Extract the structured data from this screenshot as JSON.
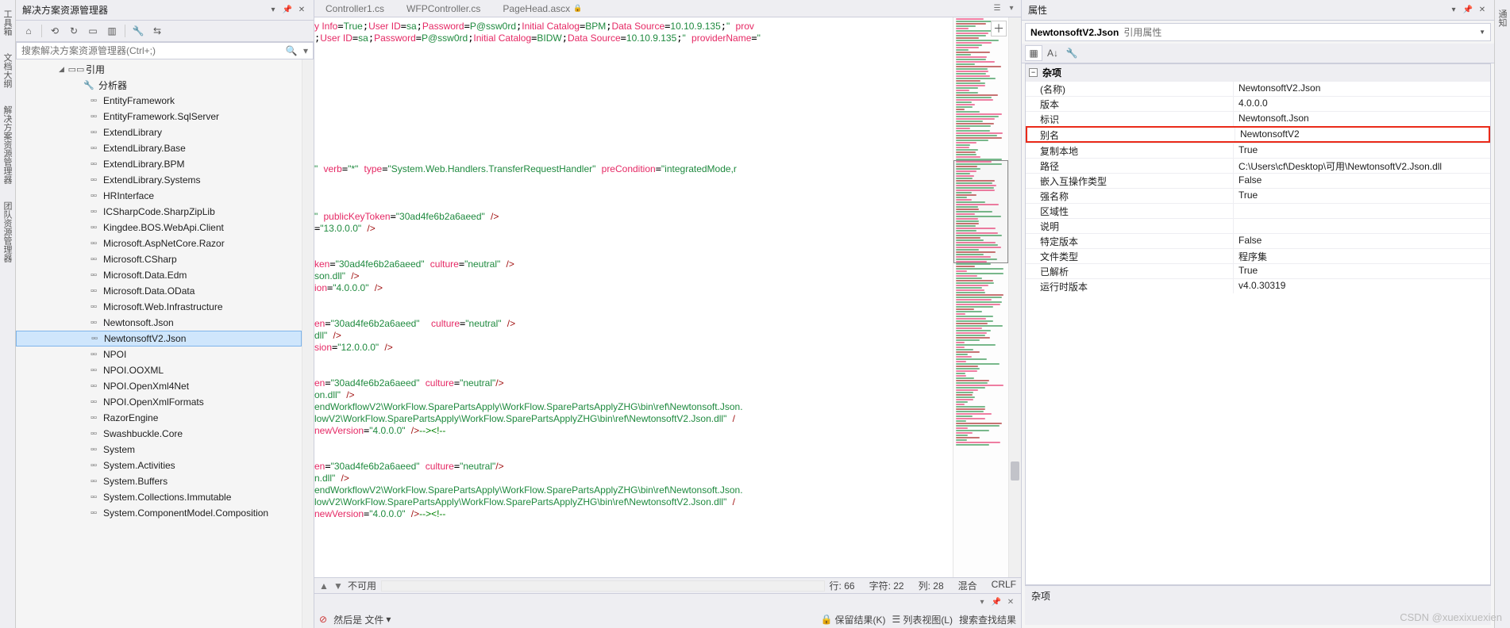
{
  "leftTabs": [
    "工具箱",
    "文档大纲",
    "解决方案资源管理器",
    "团队资源管理器"
  ],
  "rightTab": "通知",
  "solution": {
    "title": "解决方案资源管理器",
    "searchPlaceholder": "搜索解决方案资源管理器(Ctrl+;)",
    "root": "引用",
    "analyzer": "分析器",
    "refs": [
      "EntityFramework",
      "EntityFramework.SqlServer",
      "ExtendLibrary",
      "ExtendLibrary.Base",
      "ExtendLibrary.BPM",
      "ExtendLibrary.Systems",
      "HRInterface",
      "ICSharpCode.SharpZipLib",
      "Kingdee.BOS.WebApi.Client",
      "Microsoft.AspNetCore.Razor",
      "Microsoft.CSharp",
      "Microsoft.Data.Edm",
      "Microsoft.Data.OData",
      "Microsoft.Web.Infrastructure",
      "Newtonsoft.Json",
      "NewtonsoftV2.Json",
      "NPOI",
      "NPOI.OOXML",
      "NPOI.OpenXml4Net",
      "NPOI.OpenXmlFormats",
      "RazorEngine",
      "Swashbuckle.Core",
      "System",
      "System.Activities",
      "System.Buffers",
      "System.Collections.Immutable",
      "System.ComponentModel.Composition"
    ],
    "selected": "NewtonsoftV2.Json"
  },
  "editor": {
    "tabs": [
      {
        "label": "Controller1.cs"
      },
      {
        "label": "WFPController.cs"
      },
      {
        "label": "PageHead.ascx",
        "locked": true
      }
    ],
    "statusLeft": "不可用",
    "statusLine": "行: 66",
    "statusChar": "字符: 22",
    "statusCol": "列: 28",
    "statusMix": "混合",
    "statusCrlf": "CRLF",
    "findText": "然后是 文件",
    "findKeep": "保留结果(K)",
    "findList": "列表视图(L)",
    "findSearch": "搜索查找结果"
  },
  "props": {
    "title": "属性",
    "selName": "NewtonsoftV2.Json",
    "selType": "引用属性",
    "category": "杂项",
    "rows": [
      {
        "k": "(名称)",
        "v": "NewtonsoftV2.Json"
      },
      {
        "k": "版本",
        "v": "4.0.0.0"
      },
      {
        "k": "标识",
        "v": "Newtonsoft.Json"
      },
      {
        "k": "别名",
        "v": "NewtonsoftV2",
        "hl": true
      },
      {
        "k": "复制本地",
        "v": "True"
      },
      {
        "k": "路径",
        "v": "C:\\Users\\cf\\Desktop\\可用\\NewtonsoftV2.Json.dll"
      },
      {
        "k": "嵌入互操作类型",
        "v": "False"
      },
      {
        "k": "强名称",
        "v": "True"
      },
      {
        "k": "区域性",
        "v": ""
      },
      {
        "k": "说明",
        "v": ""
      },
      {
        "k": "特定版本",
        "v": "False"
      },
      {
        "k": "文件类型",
        "v": "程序集"
      },
      {
        "k": "已解析",
        "v": "True"
      },
      {
        "k": "运行时版本",
        "v": "v4.0.30319"
      }
    ],
    "descTitle": "杂项"
  },
  "watermark": "CSDN @xuexixuexien"
}
